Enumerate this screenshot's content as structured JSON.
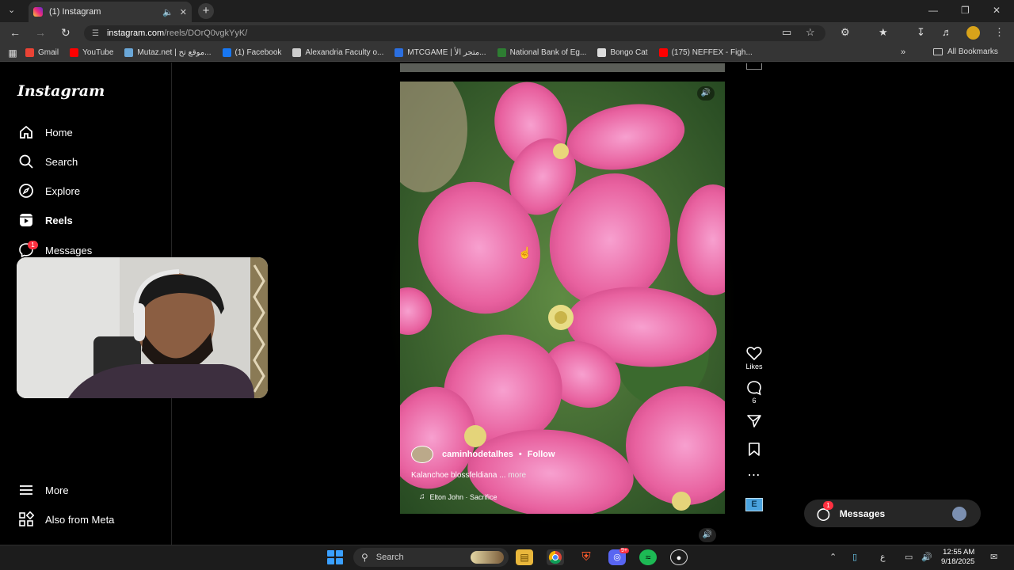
{
  "browser": {
    "tab": {
      "title": "(1) Instagram",
      "audio_icon": "speaker-icon",
      "close_icon": "close-icon"
    },
    "new_tab": "+",
    "url": {
      "host": "instagram.com",
      "path": "/reels/DOrQ0vgkYyK/"
    },
    "bookmarks": [
      {
        "label": "Gmail",
        "icon": "gmail-icon",
        "color": "#ea4335"
      },
      {
        "label": "YouTube",
        "icon": "youtube-icon",
        "color": "#ff0000"
      },
      {
        "label": "Mutaz.net | موقع تح...",
        "icon": "mutaz-icon",
        "color": "#6aa7d8"
      },
      {
        "label": "(1) Facebook",
        "icon": "facebook-icon",
        "color": "#1877f2"
      },
      {
        "label": "Alexandria Faculty o...",
        "icon": "alexandria-icon",
        "color": "#cccccc"
      },
      {
        "label": "MTCGAME | متجر الأ...",
        "icon": "mtcgame-icon",
        "color": "#2b6fe0"
      },
      {
        "label": "National Bank of Eg...",
        "icon": "nbe-icon",
        "color": "#2e7d32"
      },
      {
        "label": "Bongo Cat",
        "icon": "bongo-cat-icon",
        "color": "#dddddd"
      },
      {
        "label": "(175) NEFFEX - Figh...",
        "icon": "youtube-icon",
        "color": "#ff0000"
      }
    ],
    "all_bookmarks": "All Bookmarks"
  },
  "instagram": {
    "logo": "Instagram",
    "nav": {
      "home": "Home",
      "search": "Search",
      "explore": "Explore",
      "reels": "Reels",
      "messages": "Messages",
      "messages_badge": "1",
      "more": "More",
      "meta": "Also from Meta"
    },
    "reel": {
      "author": "caminhodetalhes",
      "follow": "Follow",
      "caption": "Kalanchoe blossfeldiana ...",
      "caption_more": "more",
      "audio": "Elton John · Sacrifice",
      "likes_label": "Likes",
      "comments_count": "6",
      "effect_letter": "E"
    },
    "messages_pill": {
      "label": "Messages",
      "badge": "1"
    }
  },
  "taskbar": {
    "search_placeholder": "Search",
    "discord_badge": "9+",
    "time": "12:55 AM",
    "date": "9/18/2025",
    "lang": "ع"
  },
  "colors": {
    "accent_pink": "#e86aa8",
    "badge_red": "#ff3040",
    "chrome_bg": "#353535"
  }
}
